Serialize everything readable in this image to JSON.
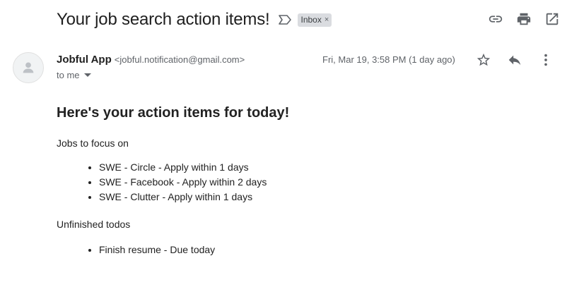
{
  "subject": "Your job search action items!",
  "label": "Inbox",
  "label_remove": "×",
  "sender": {
    "name": "Jobful App",
    "email": "<jobful.notification@gmail.com>"
  },
  "recipient": "to me",
  "date": "Fri, Mar 19, 3:58 PM (1 day ago)",
  "icons": {
    "top": [
      "link-icon",
      "print-icon",
      "open-in-new-window-icon"
    ],
    "message": [
      "star-icon",
      "reply-icon",
      "more-vert-icon"
    ]
  },
  "email_body": {
    "heading": "Here's your action items for today!",
    "jobs_title": "Jobs to focus on",
    "jobs": [
      "SWE - Circle - Apply within 1 days",
      "SWE - Facebook - Apply within 2 days",
      "SWE - Clutter - Apply within 1 days"
    ],
    "todos_title": "Unfinished todos",
    "todos": [
      "Finish resume - Due today"
    ]
  }
}
